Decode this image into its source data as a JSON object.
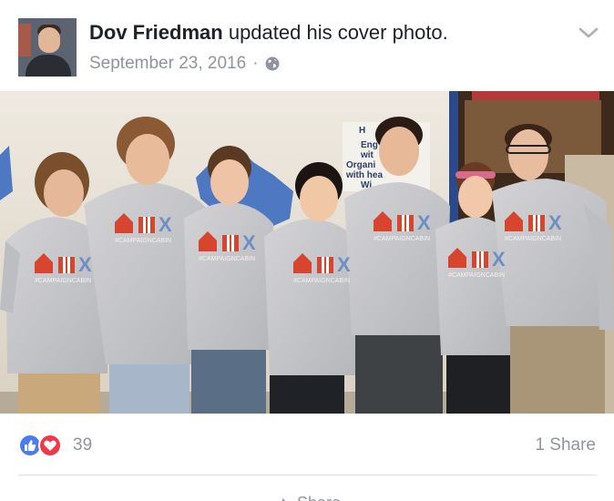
{
  "post": {
    "author": "Dov Friedman",
    "action": "updated his cover photo.",
    "date": "September 23, 2016",
    "separator": "·",
    "privacy_icon": "globe-icon",
    "menu_icon": "chevron-down-icon"
  },
  "photo": {
    "subject": "cover photo of seven people in matching campaign t-shirts",
    "shirt_hashtag": "#CAMPAIGNCABIN",
    "poster_text": [
      "H",
      "Eng",
      "wit",
      "Organi",
      "with hea",
      "Wi"
    ],
    "colors": {
      "wall": "#e8e2d6",
      "shirt": "#c9c9cc",
      "cabin_red": "#d8452e",
      "hx_blue": "#6f8fc4",
      "map_blue": "#4f78c2",
      "pole_blue": "#2b4a8c"
    }
  },
  "footer": {
    "reaction_icons": [
      "like-icon",
      "love-icon"
    ],
    "reaction_count": "39",
    "share_count": "1 Share",
    "share_action_label": "Share",
    "colors": {
      "like": "#4a7bf0",
      "love": "#f0384a",
      "muted_text": "#90949c"
    }
  }
}
